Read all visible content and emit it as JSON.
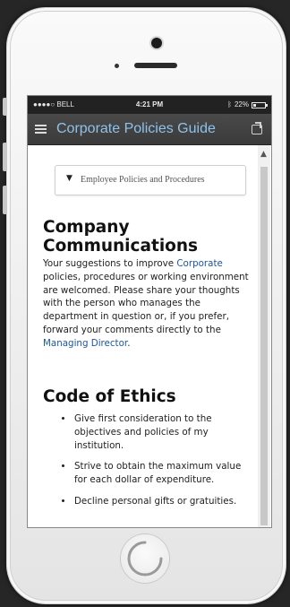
{
  "status_bar": {
    "carrier": "●●●●○ BELL",
    "time": "4:21 PM",
    "battery_text": "22%",
    "bluetooth_icon": "bluetooth-icon",
    "battery_level": 0.22
  },
  "nav": {
    "title": "Corporate Policies Guide",
    "menu_icon": "menu-icon",
    "share_icon": "share-icon"
  },
  "dropdown": {
    "selected": "Employee Policies and Procedures"
  },
  "section1": {
    "title_line1": "Company",
    "title_line2": "Communications",
    "text_before_link": "Your suggestions to improve",
    "link1": "Corporate",
    "text_middle": "policies, procedures or working environment are welcomed. Please share your thoughts with the person who manages the department in question or, if you prefer, forward your comments directly to the",
    "link2": "Managing Director",
    "text_end": "."
  },
  "section2": {
    "title": "Code of Ethics",
    "bullets": [
      "Give first consideration to the objectives and policies of my institution.",
      "Strive to obtain the maximum value for each dollar of expenditure.",
      "Decline personal gifts or gratuities."
    ]
  },
  "colors": {
    "nav_title": "#8fc2ea",
    "link": "#1e56a0",
    "navbar": "#3f3f3f"
  }
}
